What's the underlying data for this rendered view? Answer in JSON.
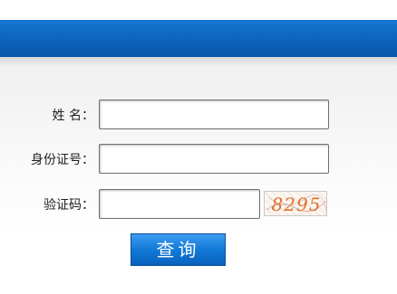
{
  "form": {
    "name_label": "姓 名：",
    "name_value": "",
    "id_label": "身份证号：",
    "id_value": "",
    "captcha_label": "验证码：",
    "captcha_value": "",
    "captcha_image_text": "8295",
    "submit_label": "查询"
  },
  "colors": {
    "header_blue": "#0d63bd",
    "button_blue": "#1279d8",
    "captcha_orange": "#e0702e"
  }
}
